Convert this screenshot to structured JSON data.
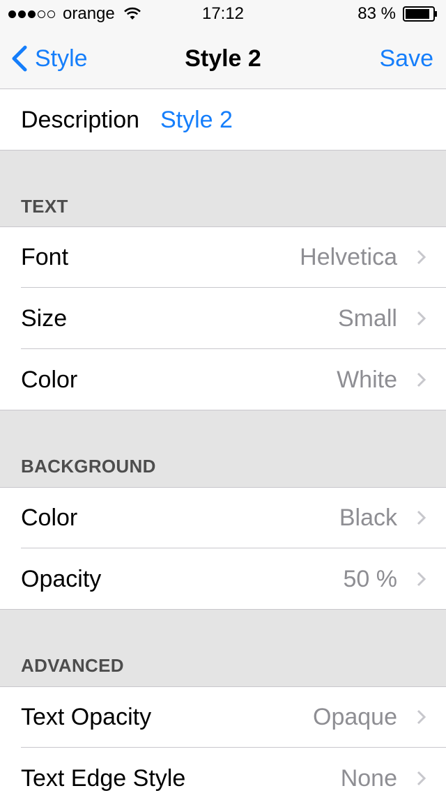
{
  "status_bar": {
    "carrier": "orange",
    "time": "17:12",
    "battery": "83 %"
  },
  "nav": {
    "back_label": "Style",
    "title": "Style 2",
    "save_label": "Save"
  },
  "description": {
    "label": "Description",
    "value": "Style 2"
  },
  "sections": {
    "text": {
      "header": "TEXT",
      "rows": [
        {
          "label": "Font",
          "value": "Helvetica"
        },
        {
          "label": "Size",
          "value": "Small"
        },
        {
          "label": "Color",
          "value": "White"
        }
      ]
    },
    "background": {
      "header": "BACKGROUND",
      "rows": [
        {
          "label": "Color",
          "value": "Black"
        },
        {
          "label": "Opacity",
          "value": "50 %"
        }
      ]
    },
    "advanced": {
      "header": "ADVANCED",
      "rows": [
        {
          "label": "Text Opacity",
          "value": "Opaque"
        },
        {
          "label": "Text Edge Style",
          "value": "None"
        }
      ]
    }
  },
  "colors": {
    "accent": "#157efb",
    "secondary_text": "#8e8e93",
    "group_background": "#e4e4e4"
  }
}
